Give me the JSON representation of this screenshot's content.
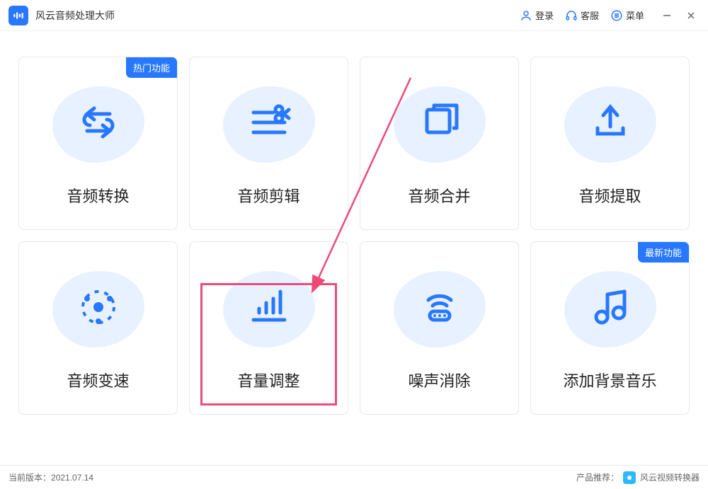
{
  "app": {
    "title": "风云音频处理大师"
  },
  "header": {
    "login": "登录",
    "support": "客服",
    "menu": "菜单"
  },
  "cards": [
    {
      "id": "convert",
      "label": "音频转换",
      "badge": "热门功能"
    },
    {
      "id": "edit",
      "label": "音频剪辑",
      "badge": null
    },
    {
      "id": "merge",
      "label": "音频合并",
      "badge": null
    },
    {
      "id": "extract",
      "label": "音频提取",
      "badge": null
    },
    {
      "id": "speed",
      "label": "音频变速",
      "badge": null
    },
    {
      "id": "volume",
      "label": "音量调整",
      "badge": null,
      "highlighted": true
    },
    {
      "id": "denoise",
      "label": "噪声消除",
      "badge": null
    },
    {
      "id": "bgm",
      "label": "添加背景音乐",
      "badge": "最新功能"
    }
  ],
  "footer": {
    "version_label": "当前版本：",
    "version": "2021.07.14",
    "recommend_label": "产品推荐：",
    "recommend_product": "风云视频转换器"
  },
  "colors": {
    "primary": "#2878ff",
    "highlight": "#ec4b7a",
    "blob": "#e8f1ff"
  }
}
